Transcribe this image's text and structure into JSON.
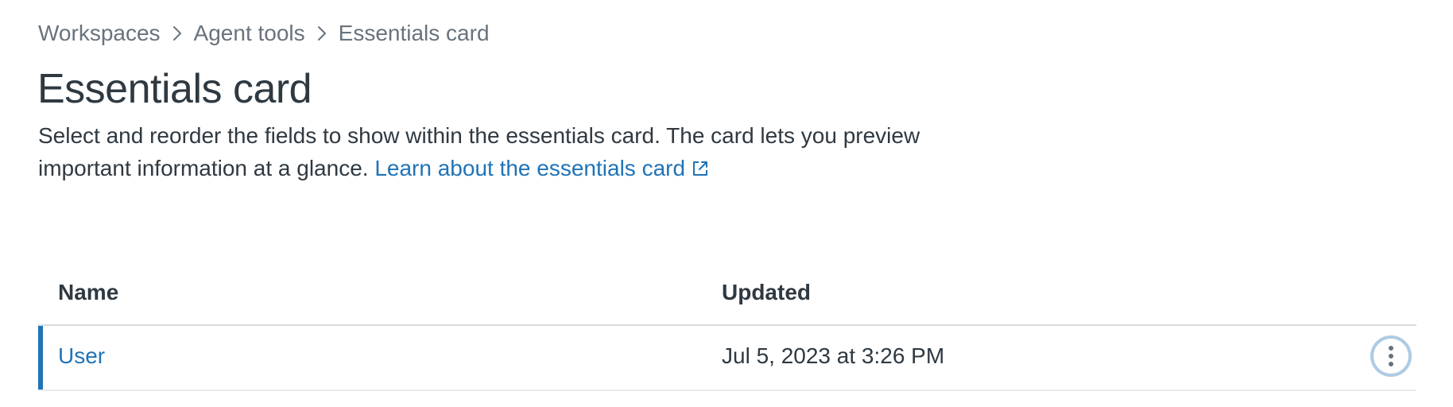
{
  "breadcrumb": {
    "items": [
      "Workspaces",
      "Agent tools",
      "Essentials card"
    ],
    "separator_icon": "chevron-right-icon"
  },
  "page": {
    "title": "Essentials card",
    "description": "Select and reorder the fields to show within the essentials card. The card lets you preview important information at a glance.",
    "learn_link": "Learn about the essentials card",
    "learn_link_icon": "external-link-icon"
  },
  "table": {
    "columns": {
      "name": "Name",
      "updated": "Updated"
    },
    "rows": [
      {
        "name": "User",
        "updated": "Jul 5, 2023 at 3:26 PM",
        "menu_icon": "overflow-vertical-icon"
      }
    ]
  },
  "colors": {
    "link": "#1f73b7",
    "text": "#2f3941",
    "muted": "#68737d",
    "border": "#d8dcde",
    "focus_ring": "#aecbe3"
  }
}
